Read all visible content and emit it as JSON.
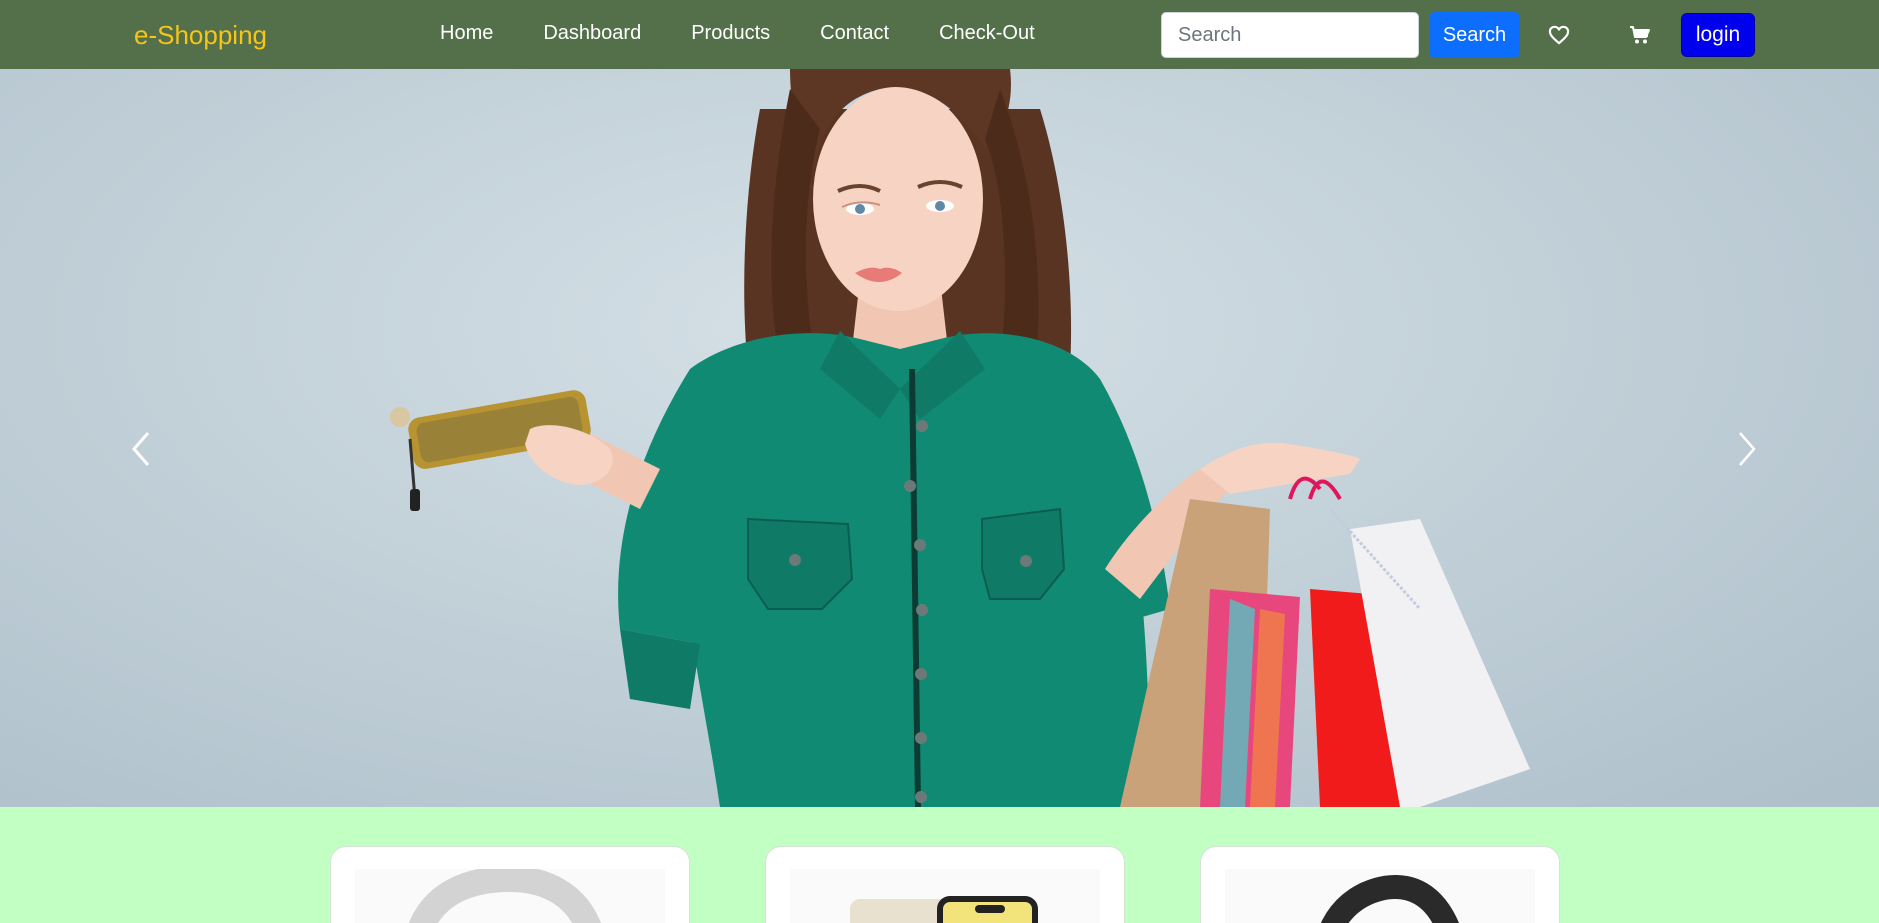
{
  "navbar": {
    "brand": "e-Shopping",
    "links": [
      "Home",
      "Dashboard",
      "Products",
      "Contact",
      "Check-Out"
    ],
    "search": {
      "placeholder": "Search",
      "value": ""
    },
    "search_button": "Search",
    "wishlist_icon": "heart-icon",
    "cart_icon": "cart-icon",
    "login_button": "login"
  },
  "colors": {
    "navbar_bg": "#54704a",
    "brand": "#f5c518",
    "search_button": "#0d6efd",
    "login_button": "#0000ee",
    "products_bg": "#c1ffc3"
  },
  "hero": {
    "prev_icon": "chevron-left-icon",
    "next_icon": "chevron-right-icon"
  },
  "products": {
    "cards": [
      {
        "icon": "headphones-image"
      },
      {
        "icon": "smartphone-image"
      },
      {
        "icon": "smartwatch-image"
      }
    ]
  }
}
